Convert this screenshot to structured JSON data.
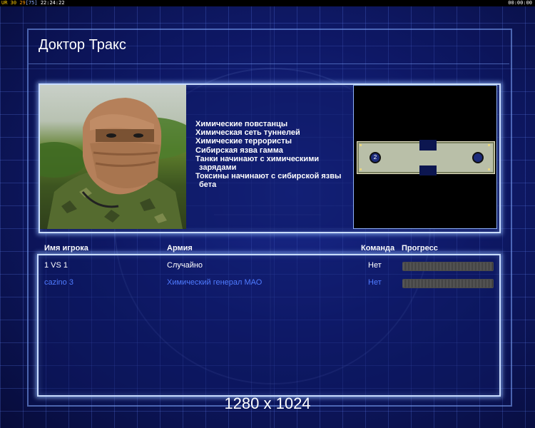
{
  "statusbar": {
    "ur": "UR",
    "n30": "30",
    "n29": "29",
    "n75": "[75]",
    "time_left": "22:24:22",
    "time_right": "00:00:00"
  },
  "screen": {
    "title": "Доктор Тракс"
  },
  "general_info": {
    "lines": [
      "Химические повстанцы",
      "Химическая сеть туннелей",
      "Химические террористы",
      "Сибирская язва гамма",
      "Танки начинают с химическими",
      "зарядами",
      "Токсины начинают с сибирской язвы",
      "бета"
    ]
  },
  "minimap": {
    "start_position_label": "2"
  },
  "players_table": {
    "headers": {
      "name": "Имя игрока",
      "army": "Армия",
      "team": "Команда",
      "progress": "Прогресс"
    },
    "rows": [
      {
        "name": "1 VS 1",
        "army": "Случайно",
        "team": "Нет",
        "color": "#ffffff"
      },
      {
        "name": "cazino 3",
        "army": "Химический генерал МАО",
        "team": "Нет",
        "color": "#4f7bff"
      }
    ]
  },
  "resolution_text": "1280 x 1024"
}
